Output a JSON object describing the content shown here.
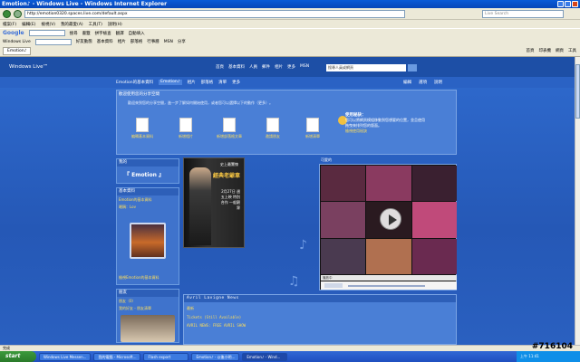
{
  "window": {
    "title": "Emotion♪ - Windows Live - Windows Internet Explorer"
  },
  "address": {
    "url": "http://emotion0320.spaces.live.com/default.aspx",
    "search_placeholder": "Live Search"
  },
  "menubar": [
    "檔案(F)",
    "編輯(E)",
    "檢視(V)",
    "我的最愛(A)",
    "工具(T)",
    "說明(H)"
  ],
  "toolbar_google": {
    "logo": "Google",
    "items": [
      "搜尋",
      "書籤",
      "拼字檢查",
      "翻譯",
      "自動填入"
    ]
  },
  "toolbar_live": {
    "logo": "Windows Live",
    "items": [
      "好友動態",
      "基本資料",
      "相片",
      "部落格",
      "行事曆",
      "MSN",
      "分享"
    ]
  },
  "tabs": [
    {
      "label": "Emotion♪"
    }
  ],
  "tab_right": [
    "首頁",
    "印表機",
    "網頁",
    "工具"
  ],
  "wl": {
    "logo": "Windows Live™",
    "nav": [
      "首頁",
      "基本資料",
      "人員",
      "郵件",
      "相片",
      "更多",
      "MSN"
    ],
    "search_placeholder": "搜尋人員或網頁"
  },
  "subnav": {
    "tabs": [
      "Emotion的基本資料",
      "Emotion♪",
      "相片",
      "部落格",
      "清單",
      "更多"
    ],
    "right": [
      "編輯",
      "選項",
      "說明"
    ]
  },
  "welcome": {
    "title": "歡迎使用您的分享空間",
    "text": "歡迎來到您的分享空間，進一步了解如何開始使用，或者您可以選擇以下的動作（更多）。",
    "items": [
      "編輯基本資料",
      "新增相片",
      "新增部落格文章",
      "邀請朋友",
      "新增清單"
    ],
    "help_title": "使用秘訣：",
    "help_text": "您可以將網頁模組移動到您想要的位置，並且使用拖曳來排列您的版面。",
    "help_link": "檢視使用秘訣"
  },
  "left": {
    "emotion_hd": "我的",
    "emotion_title": "『 Emotion 』",
    "profile_hd": "基本資料",
    "profile_lines": [
      "Emotion的基本資料",
      "暱稱：Lov"
    ],
    "profile_link": "檢視Emotion的基本資料",
    "friends_hd": "朋友",
    "friends_lines": [
      "朋友（0）",
      "我的好友 - 朋友清單"
    ]
  },
  "poster": {
    "t1": "史上最驚悚",
    "t2": "經典老爺車",
    "t3": "2月27日 週五上映 特別合作 一般觀眾"
  },
  "video": {
    "label": "可愛的",
    "player_bar": "播放中"
  },
  "lyrics": {
    "hd": "Avril Lavigne News",
    "lines": [
      "最新",
      "Tickets (Still Available)",
      "AVRIL NEWS: FREE AVRIL SHOW"
    ]
  },
  "statusbar": {
    "text": "完成"
  },
  "taskbar": {
    "start": "start",
    "buttons": [
      "Windows Live Messen...",
      "我的電腦 - Microsoft...",
      "Flash export",
      "Emotion♪ - 以後小明...",
      "Emotion♪ - Wind..."
    ],
    "tray": "上午 11:41"
  },
  "watermark": "#716104"
}
